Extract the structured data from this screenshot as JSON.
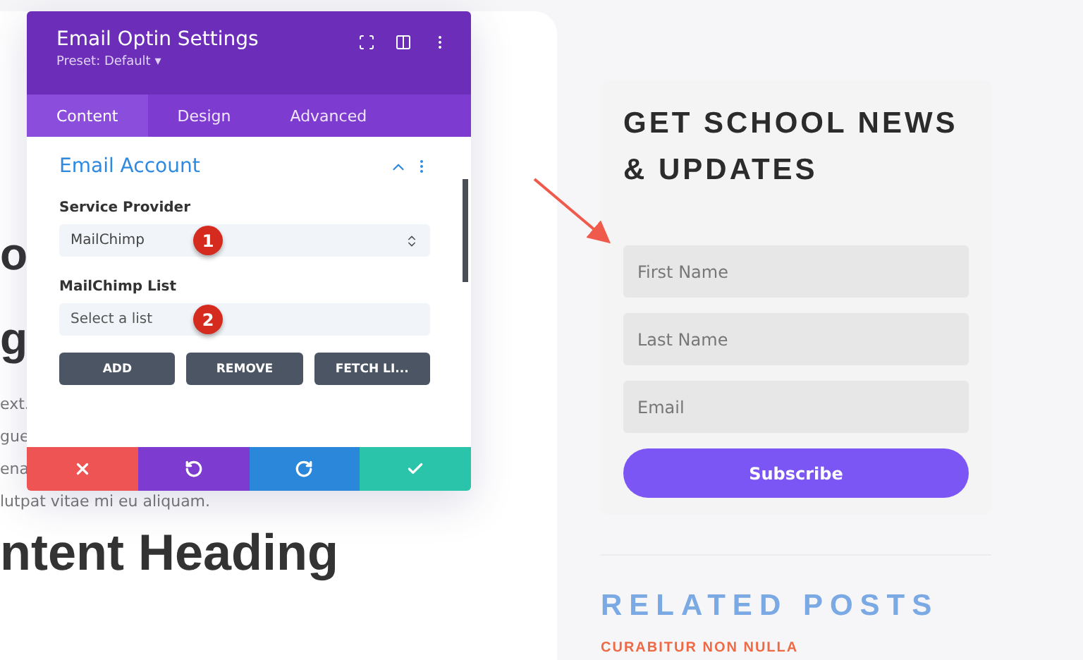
{
  "page": {
    "fragments": [
      {
        "kind": "heading",
        "text": "o"
      },
      {
        "kind": "heading",
        "text": "g"
      },
      {
        "kind": "body",
        "text": "ext."
      },
      {
        "kind": "body",
        "text": "gue"
      },
      {
        "kind": "body",
        "text": "ena"
      },
      {
        "kind": "body",
        "text": "lutpat vitae mi eu aliquam."
      },
      {
        "kind": "heading",
        "text": "ntent Heading"
      }
    ]
  },
  "settings_panel": {
    "title": "Email Optin Settings",
    "preset": "Preset: Default ▾",
    "tabs": [
      {
        "label": "Content",
        "selected": true
      },
      {
        "label": "Design",
        "selected": false
      },
      {
        "label": "Advanced",
        "selected": false
      }
    ],
    "section": {
      "title": "Email Account",
      "expanded": true
    },
    "fields": [
      {
        "label": "Service Provider",
        "kind": "dropdown",
        "value": "MailChimp",
        "badge": "1"
      },
      {
        "label": "MailChimp List",
        "kind": "plain",
        "value": "Select a list",
        "badge": "2"
      }
    ],
    "buttons": [
      "ADD",
      "REMOVE",
      "FETCH LI..."
    ],
    "footer": [
      {
        "kind": "cancel"
      },
      {
        "kind": "undo"
      },
      {
        "kind": "redo"
      },
      {
        "kind": "save"
      }
    ]
  },
  "signup": {
    "title": "GET SCHOOL NEWS & UPDATES",
    "fields": [
      {
        "placeholder": "First Name"
      },
      {
        "placeholder": "Last Name"
      },
      {
        "placeholder": "Email"
      }
    ],
    "button": "Subscribe"
  },
  "related": {
    "title": "RELATED POSTS",
    "post": "CURABITUR NON NULLA"
  }
}
